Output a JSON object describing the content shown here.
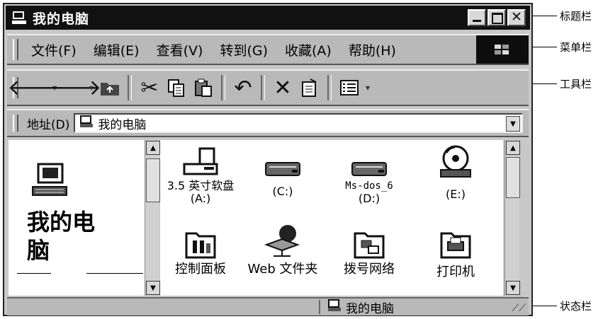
{
  "window": {
    "title": "我的电脑",
    "buttons": [
      "minimize-icon",
      "maximize-icon",
      "close-icon"
    ]
  },
  "menu": {
    "items": [
      "文件(F)",
      "编辑(E)",
      "查看(V)",
      "转到(G)",
      "收藏(A)",
      "帮助(H)"
    ]
  },
  "toolbar": {
    "icons": [
      "back-arrow-icon",
      "forward-arrow-icon",
      "up-folder-icon",
      "cut-icon",
      "copy-icon",
      "paste-icon",
      "undo-icon",
      "delete-icon",
      "properties-icon",
      "views-icon"
    ]
  },
  "address": {
    "label": "地址(D)",
    "value": "我的电脑"
  },
  "left_panel": {
    "title_line1": "我的电",
    "title_line2": "脑"
  },
  "items": [
    {
      "label": "3.5 英寸软盘",
      "sub": "(A:)",
      "icon": "floppy-drive-icon"
    },
    {
      "label": "(C:)",
      "sub": "",
      "icon": "hard-drive-icon"
    },
    {
      "label": "Ms-dos_6",
      "sub": "(D:)",
      "icon": "hard-drive-icon"
    },
    {
      "label": "(E:)",
      "sub": "",
      "icon": "cd-drive-icon"
    },
    {
      "label": "控制面板",
      "sub": "",
      "icon": "control-panel-icon"
    },
    {
      "label": "Web 文件夹",
      "sub": "",
      "icon": "web-folder-icon"
    },
    {
      "label": "拨号网络",
      "sub": "",
      "icon": "dialup-network-icon"
    },
    {
      "label": "打印机",
      "sub": "",
      "icon": "printer-icon"
    }
  ],
  "status": {
    "text": "我的电脑"
  },
  "callouts": {
    "title_bar": "标题栏",
    "menu_bar": "菜单栏",
    "tool_bar": "工具栏",
    "status_bar": "状态栏"
  }
}
